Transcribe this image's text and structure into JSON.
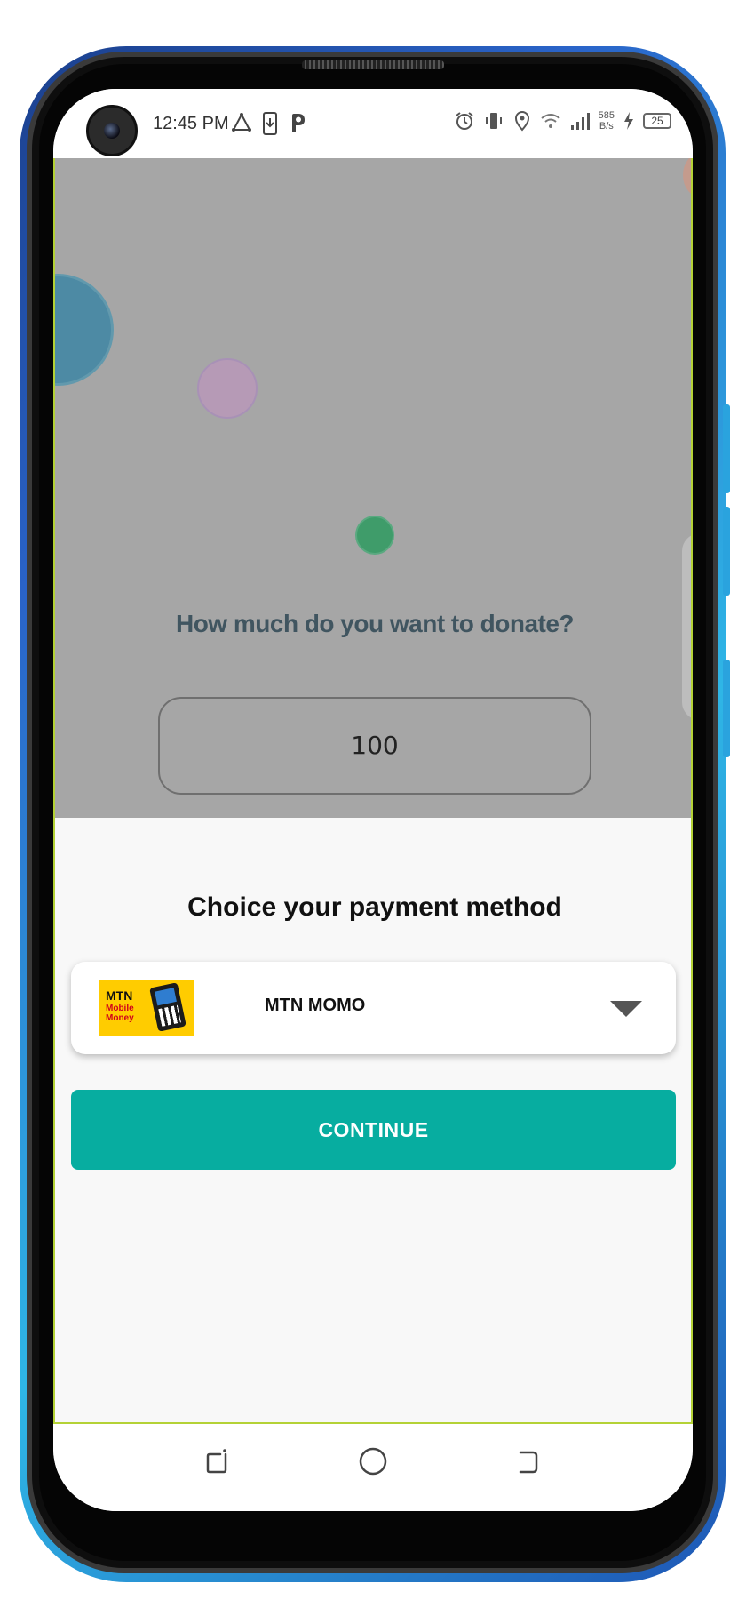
{
  "status_bar": {
    "time": "12:45 PM",
    "net_speed_value": "585",
    "net_speed_unit": "B/s",
    "battery_level": "25"
  },
  "donation": {
    "question": "How much do you want to donate?",
    "amount": "100"
  },
  "payment": {
    "title": "Choice your payment method",
    "selected_method": "MTN MOMO",
    "logo_line1": "MTN",
    "logo_line2": "Mobile",
    "logo_line3": "Money"
  },
  "actions": {
    "continue_label": "CONTINUE"
  },
  "colors": {
    "accent": "#07ada0",
    "overlay": "#a6a6a6",
    "question_text": "#405560",
    "mtn_yellow": "#ffcc00"
  }
}
